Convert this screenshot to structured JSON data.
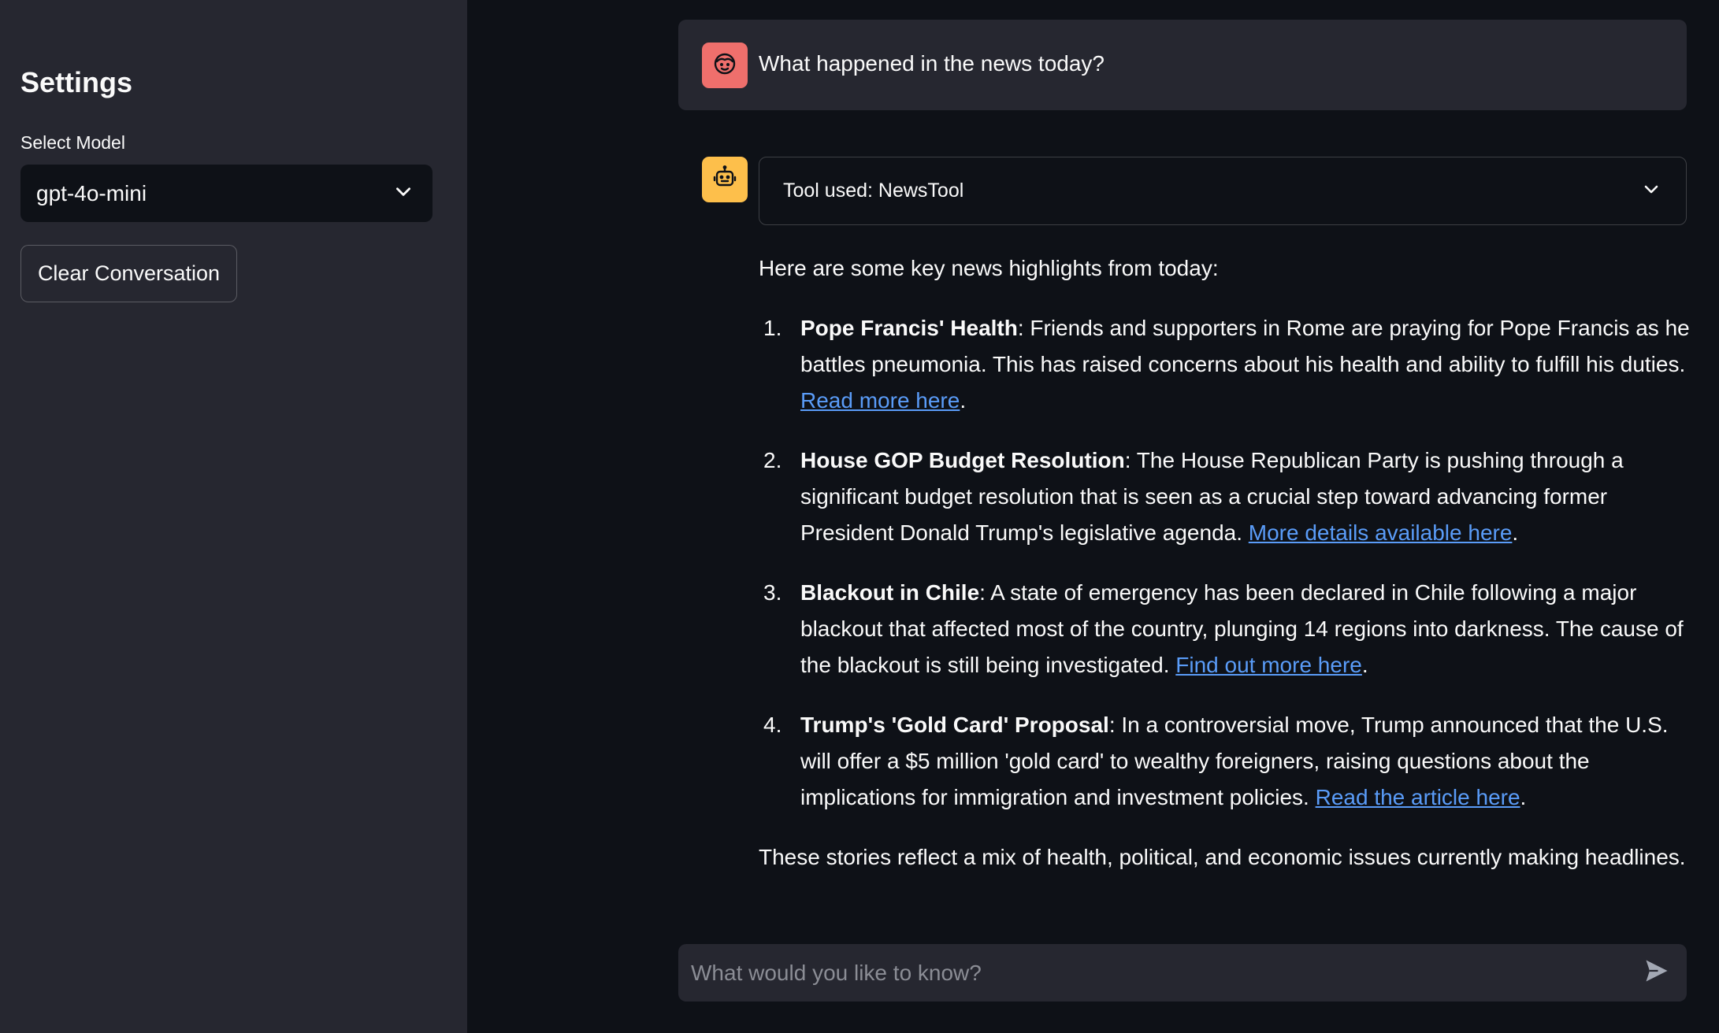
{
  "sidebar": {
    "title": "Settings",
    "model_label": "Select Model",
    "model_value": "gpt-4o-mini",
    "clear_button": "Clear Conversation"
  },
  "chat": {
    "user_message": "What happened in the news today?",
    "tool_expander_label": "Tool used: NewsTool",
    "answer": {
      "intro": "Here are some key news highlights from today:",
      "items": [
        {
          "num": "1.",
          "title": "Pope Francis' Health",
          "text": ": Friends and supporters in Rome are praying for Pope Francis as he battles pneumonia. This has raised concerns about his health and ability to fulfill his duties. ",
          "link": "Read more here",
          "after": "."
        },
        {
          "num": "2.",
          "title": "House GOP Budget Resolution",
          "text": ": The House Republican Party is pushing through a significant budget resolution that is seen as a crucial step toward advancing former President Donald Trump's legislative agenda. ",
          "link": "More details available here",
          "after": "."
        },
        {
          "num": "3.",
          "title": "Blackout in Chile",
          "text": ": A state of emergency has been declared in Chile following a major blackout that affected most of the country, plunging 14 regions into darkness. The cause of the blackout is still being investigated. ",
          "link": "Find out more here",
          "after": "."
        },
        {
          "num": "4.",
          "title": "Trump's 'Gold Card' Proposal",
          "text": ": In a controversial move, Trump announced that the U.S. will offer a $5 million 'gold card' to wealthy foreigners, raising questions about the implications for immigration and investment policies. ",
          "link": "Read the article here",
          "after": "."
        }
      ],
      "outro": "These stories reflect a mix of health, political, and economic issues currently making headlines."
    },
    "input_placeholder": "What would you like to know?"
  },
  "icons": {
    "user_avatar": "user-face-icon",
    "bot_avatar": "robot-icon",
    "dropdown": "chevron-down-icon",
    "expander": "chevron-down-icon",
    "send": "send-icon"
  },
  "colors": {
    "background": "#0e1117",
    "sidebar": "#262730",
    "user_avatar": "#ef6f6c",
    "bot_avatar": "#fdbf4b",
    "link": "#5a9cf8"
  }
}
